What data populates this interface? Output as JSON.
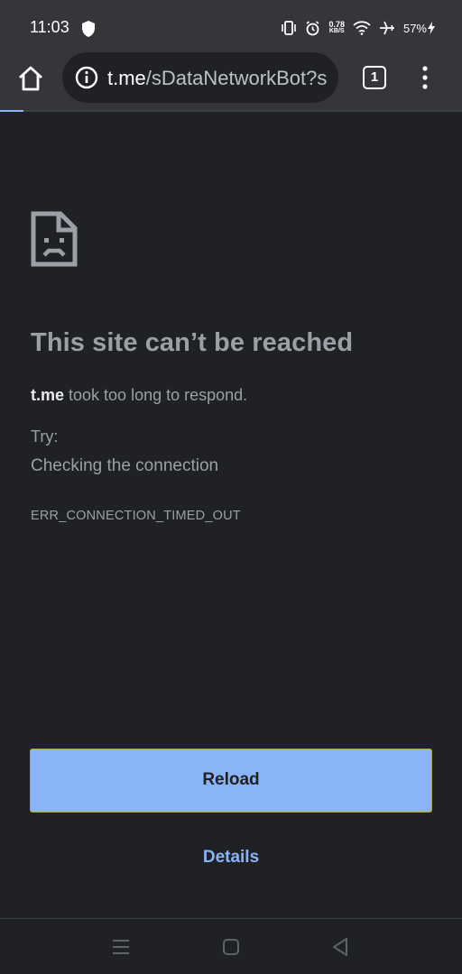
{
  "status_bar": {
    "time": "11:03",
    "net_speed_value": "0.78",
    "net_speed_unit": "KB/S",
    "battery": "57%"
  },
  "toolbar": {
    "url_host": "t.me",
    "url_path": "/sDataNetworkBot?s",
    "tab_count": "1"
  },
  "error_page": {
    "headline": "This site can’t be reached",
    "host": "t.me",
    "message_rest": " took too long to respond.",
    "try_label": "Try:",
    "suggestion": "Checking the connection",
    "error_code": "ERR_CONNECTION_TIMED_OUT",
    "reload_label": "Reload",
    "details_label": "Details"
  },
  "colors": {
    "background": "#202124",
    "toolbar": "#35363a",
    "accent": "#8ab4f8",
    "text_muted": "#9aa0a6"
  },
  "loading_progress": 0.05
}
